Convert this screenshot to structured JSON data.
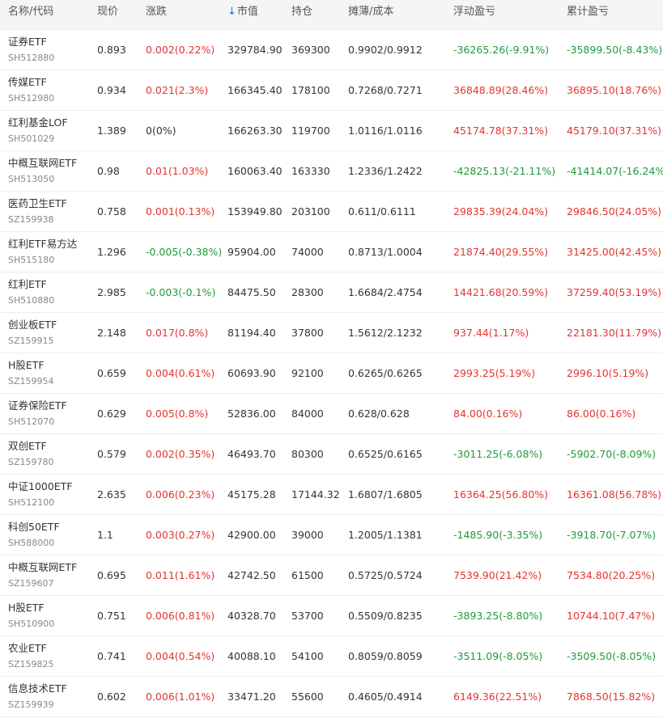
{
  "colors": {
    "up": "#e3342f",
    "down": "#1f9a3a",
    "flat": "#333333",
    "sort_arrow": "#2b6cd8"
  },
  "header": {
    "name_code": "名称/代码",
    "price": "现价",
    "change": "涨跌",
    "sort_icon": "↓",
    "market_value": "市值",
    "holding": "持仓",
    "cost": "摊薄/成本",
    "float_pl": "浮动盈亏",
    "total_pl": "累计盈亏"
  },
  "rows": [
    {
      "name": "证券ETF",
      "code": "SH512880",
      "price": "0.893",
      "change": "0.002(0.22%)",
      "change_dir": "up",
      "market_value": "329784.90",
      "holding": "369300",
      "cost": "0.9902/0.9912",
      "float_pl": "-36265.26(-9.91%)",
      "float_dir": "down",
      "total_pl": "-35899.50(-8.43%)",
      "total_dir": "down"
    },
    {
      "name": "传媒ETF",
      "code": "SH512980",
      "price": "0.934",
      "change": "0.021(2.3%)",
      "change_dir": "up",
      "market_value": "166345.40",
      "holding": "178100",
      "cost": "0.7268/0.7271",
      "float_pl": "36848.89(28.46%)",
      "float_dir": "up",
      "total_pl": "36895.10(18.76%)",
      "total_dir": "up"
    },
    {
      "name": "红利基金LOF",
      "code": "SH501029",
      "price": "1.389",
      "change": "0(0%)",
      "change_dir": "flat",
      "market_value": "166263.30",
      "holding": "119700",
      "cost": "1.0116/1.0116",
      "float_pl": "45174.78(37.31%)",
      "float_dir": "up",
      "total_pl": "45179.10(37.31%)",
      "total_dir": "up"
    },
    {
      "name": "中概互联网ETF",
      "code": "SH513050",
      "price": "0.98",
      "change": "0.01(1.03%)",
      "change_dir": "up",
      "market_value": "160063.40",
      "holding": "163330",
      "cost": "1.2336/1.2422",
      "float_pl": "-42825.13(-21.11%)",
      "float_dir": "down",
      "total_pl": "-41414.07(-16.24%)",
      "total_dir": "down"
    },
    {
      "name": "医药卫生ETF",
      "code": "SZ159938",
      "price": "0.758",
      "change": "0.001(0.13%)",
      "change_dir": "up",
      "market_value": "153949.80",
      "holding": "203100",
      "cost": "0.611/0.6111",
      "float_pl": "29835.39(24.04%)",
      "float_dir": "up",
      "total_pl": "29846.50(24.05%)",
      "total_dir": "up"
    },
    {
      "name": "红利ETF易方达",
      "code": "SH515180",
      "price": "1.296",
      "change": "-0.005(-0.38%)",
      "change_dir": "down",
      "market_value": "95904.00",
      "holding": "74000",
      "cost": "0.8713/1.0004",
      "float_pl": "21874.40(29.55%)",
      "float_dir": "up",
      "total_pl": "31425.00(42.45%)",
      "total_dir": "up"
    },
    {
      "name": "红利ETF",
      "code": "SH510880",
      "price": "2.985",
      "change": "-0.003(-0.1%)",
      "change_dir": "down",
      "market_value": "84475.50",
      "holding": "28300",
      "cost": "1.6684/2.4754",
      "float_pl": "14421.68(20.59%)",
      "float_dir": "up",
      "total_pl": "37259.40(53.19%)",
      "total_dir": "up"
    },
    {
      "name": "创业板ETF",
      "code": "SZ159915",
      "price": "2.148",
      "change": "0.017(0.8%)",
      "change_dir": "up",
      "market_value": "81194.40",
      "holding": "37800",
      "cost": "1.5612/2.1232",
      "float_pl": "937.44(1.17%)",
      "float_dir": "up",
      "total_pl": "22181.30(11.79%)",
      "total_dir": "up"
    },
    {
      "name": "H股ETF",
      "code": "SZ159954",
      "price": "0.659",
      "change": "0.004(0.61%)",
      "change_dir": "up",
      "market_value": "60693.90",
      "holding": "92100",
      "cost": "0.6265/0.6265",
      "float_pl": "2993.25(5.19%)",
      "float_dir": "up",
      "total_pl": "2996.10(5.19%)",
      "total_dir": "up"
    },
    {
      "name": "证券保险ETF",
      "code": "SH512070",
      "price": "0.629",
      "change": "0.005(0.8%)",
      "change_dir": "up",
      "market_value": "52836.00",
      "holding": "84000",
      "cost": "0.628/0.628",
      "float_pl": "84.00(0.16%)",
      "float_dir": "up",
      "total_pl": "86.00(0.16%)",
      "total_dir": "up"
    },
    {
      "name": "双创ETF",
      "code": "SZ159780",
      "price": "0.579",
      "change": "0.002(0.35%)",
      "change_dir": "up",
      "market_value": "46493.70",
      "holding": "80300",
      "cost": "0.6525/0.6165",
      "float_pl": "-3011.25(-6.08%)",
      "float_dir": "down",
      "total_pl": "-5902.70(-8.09%)",
      "total_dir": "down"
    },
    {
      "name": "中证1000ETF",
      "code": "SH512100",
      "price": "2.635",
      "change": "0.006(0.23%)",
      "change_dir": "up",
      "market_value": "45175.28",
      "holding": "17144.32",
      "cost": "1.6807/1.6805",
      "float_pl": "16364.25(56.80%)",
      "float_dir": "up",
      "total_pl": "16361.08(56.78%)",
      "total_dir": "up"
    },
    {
      "name": "科创50ETF",
      "code": "SH588000",
      "price": "1.1",
      "change": "0.003(0.27%)",
      "change_dir": "up",
      "market_value": "42900.00",
      "holding": "39000",
      "cost": "1.2005/1.1381",
      "float_pl": "-1485.90(-3.35%)",
      "float_dir": "down",
      "total_pl": "-3918.70(-7.07%)",
      "total_dir": "down"
    },
    {
      "name": "中概互联网ETF",
      "code": "SZ159607",
      "price": "0.695",
      "change": "0.011(1.61%)",
      "change_dir": "up",
      "market_value": "42742.50",
      "holding": "61500",
      "cost": "0.5725/0.5724",
      "float_pl": "7539.90(21.42%)",
      "float_dir": "up",
      "total_pl": "7534.80(20.25%)",
      "total_dir": "up"
    },
    {
      "name": "H股ETF",
      "code": "SH510900",
      "price": "0.751",
      "change": "0.006(0.81%)",
      "change_dir": "up",
      "market_value": "40328.70",
      "holding": "53700",
      "cost": "0.5509/0.8235",
      "float_pl": "-3893.25(-8.80%)",
      "float_dir": "down",
      "total_pl": "10744.10(7.47%)",
      "total_dir": "up"
    },
    {
      "name": "农业ETF",
      "code": "SZ159825",
      "price": "0.741",
      "change": "0.004(0.54%)",
      "change_dir": "up",
      "market_value": "40088.10",
      "holding": "54100",
      "cost": "0.8059/0.8059",
      "float_pl": "-3511.09(-8.05%)",
      "float_dir": "down",
      "total_pl": "-3509.50(-8.05%)",
      "total_dir": "down"
    },
    {
      "name": "信息技术ETF",
      "code": "SZ159939",
      "price": "0.602",
      "change": "0.006(1.01%)",
      "change_dir": "up",
      "market_value": "33471.20",
      "holding": "55600",
      "cost": "0.4605/0.4914",
      "float_pl": "6149.36(22.51%)",
      "float_dir": "up",
      "total_pl": "7868.50(15.82%)",
      "total_dir": "up"
    }
  ]
}
